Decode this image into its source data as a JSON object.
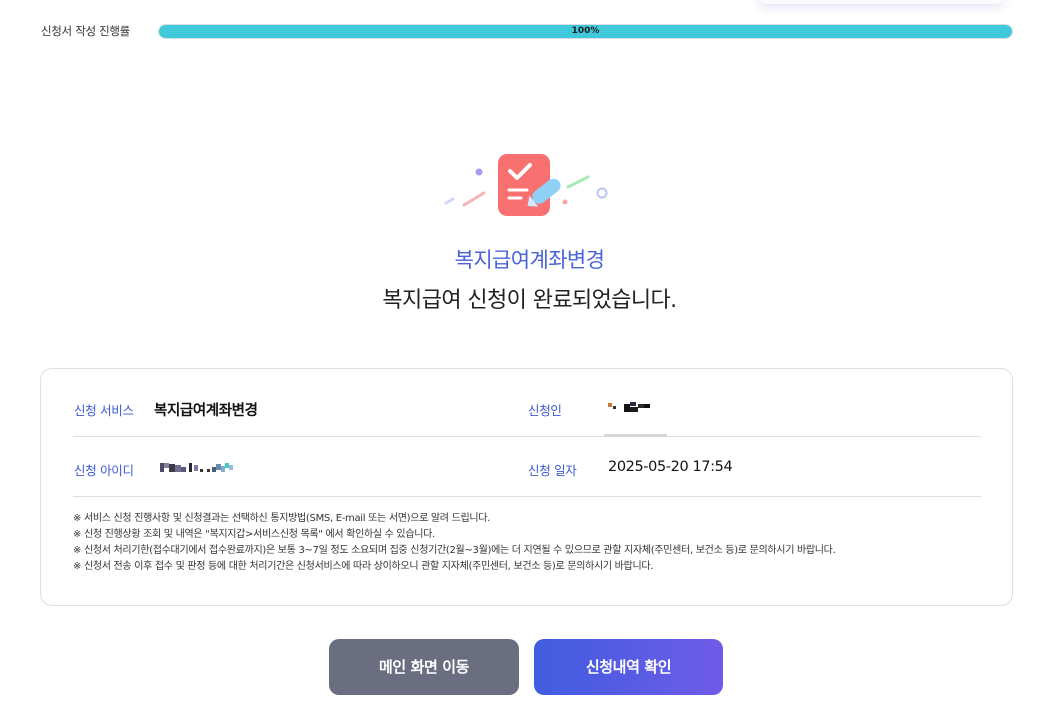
{
  "progress": {
    "label": "신청서 작성 진행률",
    "percent_text": "100%",
    "value": 1.0,
    "color": "#3fc9da"
  },
  "result": {
    "service_name": "복지급여계좌변경",
    "complete_message": "복지급여 신청이 완료되었습니다."
  },
  "details": {
    "service_label": "신청 서비스",
    "service_value": "복지급여계좌변경",
    "applicant_label": "신청인",
    "id_label": "신청 아이디",
    "date_label": "신청 일자",
    "date_value": "2025-05-20 17:54"
  },
  "notes": [
    "※ 서비스 신청 진행사항 및 신청결과는 선택하신 통지방법(SMS, E-mail 또는 서면)으로 알려 드립니다.",
    "※ 신청 진행상황 조회 및 내역은 \"복지지갑>서비스신청 목록\" 에서 확인하실 수 있습니다.",
    "※ 신청서 처리기한(접수대기에서 접수완료까지)은 보통 3~7일 정도 소요되며 집중 신청기간(2월~3월)에는 더 지연될 수 있으므로 관할 지자체(주민센터, 보건소 등)로 문의하시기 바랍니다.",
    "※ 신청서 전송 이후 접수 및 판정 등에 대한 처리기간은 신청서비스에 따라 상이하오니 관할 지자체(주민센터, 보건소 등)로 문의하시기 바랍니다."
  ],
  "buttons": {
    "main": "메인 화면 이동",
    "history": "신청내역 확인"
  },
  "colors": {
    "accent": "#4a63d9",
    "button_gray": "#6b6e80",
    "button_gradient_start": "#3f5de0",
    "button_gradient_end": "#6f5be7"
  }
}
